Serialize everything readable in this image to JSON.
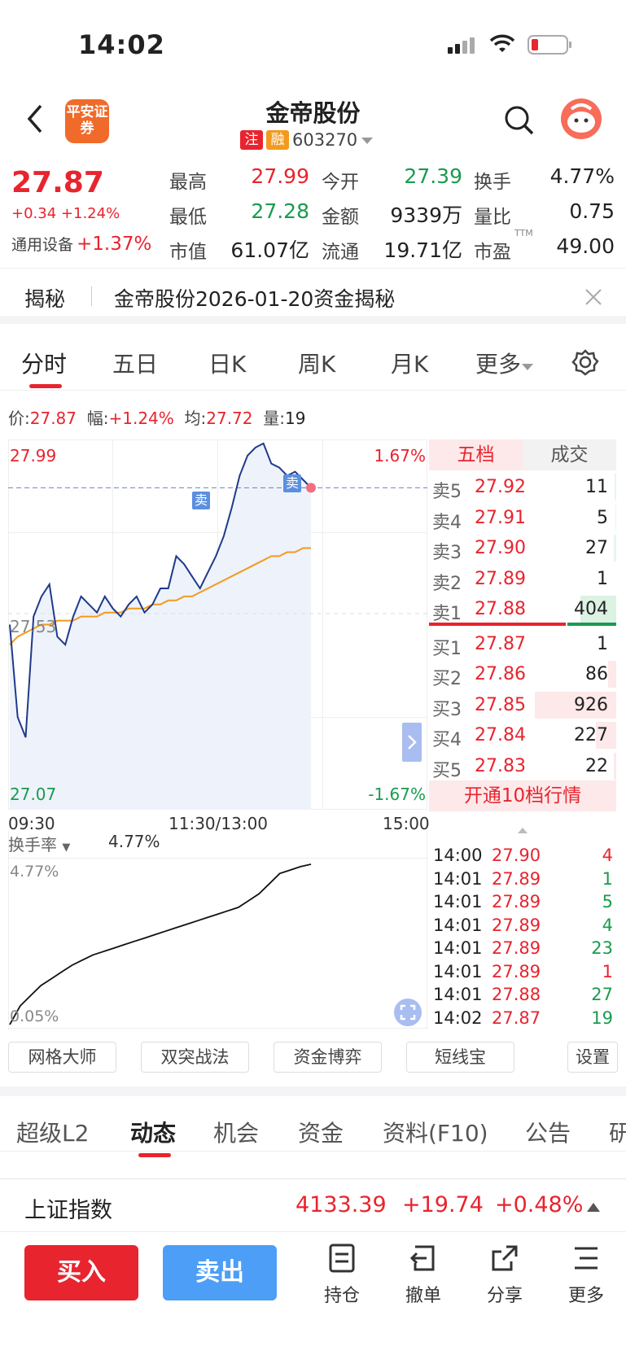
{
  "status_bar": {
    "time": "14:02"
  },
  "header": {
    "logo_text": "平安证券",
    "stock_name": "金帝股份",
    "tag_zhu": "注",
    "tag_rong": "融",
    "stock_code": "603270"
  },
  "quote": {
    "price": "27.87",
    "change": "+0.34",
    "change_pct": "+1.24%",
    "sector_name": "通用设备",
    "sector_change": "+1.37%",
    "stats": [
      {
        "label": "最高",
        "value": "27.99"
      },
      {
        "label": "今开",
        "value": "27.39"
      },
      {
        "label": "换手",
        "value": "4.77%"
      },
      {
        "label": "最低",
        "value": "27.28"
      },
      {
        "label": "金额",
        "value": "9339万"
      },
      {
        "label": "量比",
        "value": "0.75"
      },
      {
        "label": "市值",
        "value": "61.07亿"
      },
      {
        "label": "流通",
        "value": "19.71亿"
      },
      {
        "label": "市盈",
        "value": "49.00"
      }
    ],
    "pe_superscript": "TTM"
  },
  "banner": {
    "label": "揭秘",
    "text": "金帝股份2026-01-20资金揭秘"
  },
  "chart_tabs": [
    "分时",
    "五日",
    "日K",
    "周K",
    "月K",
    "更多"
  ],
  "info_line": {
    "price_label": "价:",
    "price": "27.87",
    "amp_label": "幅:",
    "amp": "+1.24%",
    "avg_label": "均:",
    "avg": "27.72",
    "vol_label": "量:",
    "vol": "19"
  },
  "chart_labels": {
    "y_high": "27.99",
    "y_mid": "27.53",
    "y_low": "27.07",
    "pct_high": "1.67%",
    "pct_low": "-1.67%",
    "x_start": "09:30",
    "x_mid": "11:30/13:00",
    "x_end": "15:00",
    "sell_marker": "卖",
    "turnover_label": "换手率",
    "turnover_value": "4.77%",
    "turnover_high": "4.77%",
    "turnover_low": "0.05%"
  },
  "chart_data": {
    "type": "line",
    "series": [
      {
        "name": "price",
        "x_range": [
          "09:30",
          "15:00"
        ],
        "values": [
          27.53,
          27.3,
          27.25,
          27.55,
          27.6,
          27.63,
          27.5,
          27.48,
          27.55,
          27.6,
          27.58,
          27.56,
          27.6,
          27.57,
          27.55,
          27.58,
          27.6,
          27.56,
          27.58,
          27.62,
          27.62,
          27.7,
          27.68,
          27.65,
          27.62,
          27.66,
          27.7,
          27.75,
          27.82,
          27.9,
          27.95,
          27.97,
          27.98,
          27.93,
          27.92,
          27.9,
          27.91,
          27.89,
          27.87
        ]
      },
      {
        "name": "average",
        "values": [
          27.48,
          27.5,
          27.51,
          27.52,
          27.53,
          27.53,
          27.54,
          27.54,
          27.54,
          27.55,
          27.55,
          27.55,
          27.56,
          27.56,
          27.56,
          27.57,
          27.57,
          27.57,
          27.58,
          27.58,
          27.59,
          27.59,
          27.6,
          27.6,
          27.61,
          27.62,
          27.63,
          27.64,
          27.65,
          27.66,
          27.67,
          27.68,
          27.69,
          27.7,
          27.7,
          27.71,
          27.71,
          27.72,
          27.72
        ]
      },
      {
        "name": "turnover",
        "values": [
          0.05,
          0.6,
          0.9,
          1.2,
          1.4,
          1.6,
          1.8,
          1.95,
          2.1,
          2.2,
          2.3,
          2.4,
          2.5,
          2.6,
          2.7,
          2.8,
          2.9,
          3.0,
          3.1,
          3.2,
          3.3,
          3.4,
          3.5,
          3.7,
          3.9,
          4.2,
          4.5,
          4.6,
          4.7,
          4.77
        ]
      }
    ],
    "ylim": [
      27.07,
      27.99
    ]
  },
  "orderbook": {
    "tab_left": "五档",
    "tab_right": "成交",
    "rows": [
      {
        "label": "卖5",
        "price": "27.92",
        "vol": "11",
        "bar": 0.02,
        "bar_color": "#e8f6ec"
      },
      {
        "label": "卖4",
        "price": "27.91",
        "vol": "5",
        "bar": 0.01,
        "bar_color": "#e8f6ec"
      },
      {
        "label": "卖3",
        "price": "27.90",
        "vol": "27",
        "bar": 0.03,
        "bar_color": "#e8f6ec"
      },
      {
        "label": "卖2",
        "price": "27.89",
        "vol": "1",
        "bar": 0.0,
        "bar_color": "#e8f6ec"
      },
      {
        "label": "卖1",
        "price": "27.88",
        "vol": "404",
        "bar": 0.44,
        "bar_color": "#dcf2e3"
      },
      {
        "label": "买1",
        "price": "27.87",
        "vol": "1",
        "bar": 0.0,
        "bar_color": "#fde9ea"
      },
      {
        "label": "买2",
        "price": "27.86",
        "vol": "86",
        "bar": 0.1,
        "bar_color": "#fde9ea"
      },
      {
        "label": "买3",
        "price": "27.85",
        "vol": "926",
        "bar": 1.0,
        "bar_color": "#fde9ea"
      },
      {
        "label": "买4",
        "price": "27.84",
        "vol": "227",
        "bar": 0.25,
        "bar_color": "#fde9ea"
      },
      {
        "label": "买5",
        "price": "27.83",
        "vol": "22",
        "bar": 0.03,
        "bar_color": "#fde9ea"
      }
    ],
    "upgrade_text": "开通10档行情"
  },
  "trades": [
    {
      "time": "14:00",
      "price": "27.90",
      "vol": "4",
      "vol_color": "#e8242e"
    },
    {
      "time": "14:01",
      "price": "27.89",
      "vol": "1",
      "vol_color": "#1a9b4f"
    },
    {
      "time": "14:01",
      "price": "27.89",
      "vol": "5",
      "vol_color": "#1a9b4f"
    },
    {
      "time": "14:01",
      "price": "27.89",
      "vol": "4",
      "vol_color": "#1a9b4f"
    },
    {
      "time": "14:01",
      "price": "27.89",
      "vol": "23",
      "vol_color": "#1a9b4f"
    },
    {
      "time": "14:01",
      "price": "27.89",
      "vol": "1",
      "vol_color": "#e8242e"
    },
    {
      "time": "14:01",
      "price": "27.88",
      "vol": "27",
      "vol_color": "#1a9b4f"
    },
    {
      "time": "14:02",
      "price": "27.87",
      "vol": "19",
      "vol_color": "#1a9b4f"
    }
  ],
  "tools": [
    "网格大师",
    "双突战法",
    "资金博弈",
    "短线宝",
    "设置"
  ],
  "bottom_tabs": [
    "超级L2",
    "动态",
    "机会",
    "资金",
    "资料(F10)",
    "公告",
    "研"
  ],
  "index_bar": {
    "name": "上证指数",
    "value": "4133.39",
    "change": "+19.74",
    "change_pct": "+0.48%"
  },
  "actions": {
    "buy": "买入",
    "sell": "卖出",
    "items": [
      "持仓",
      "撤单",
      "分享",
      "更多"
    ]
  },
  "colors": {
    "up": "#e8242e",
    "down": "#1a9b4f",
    "buy_btn": "#e8242e",
    "sell_btn": "#4d9ef6",
    "price_line": "#1f3a8a",
    "avg_line": "#f29a1f"
  }
}
